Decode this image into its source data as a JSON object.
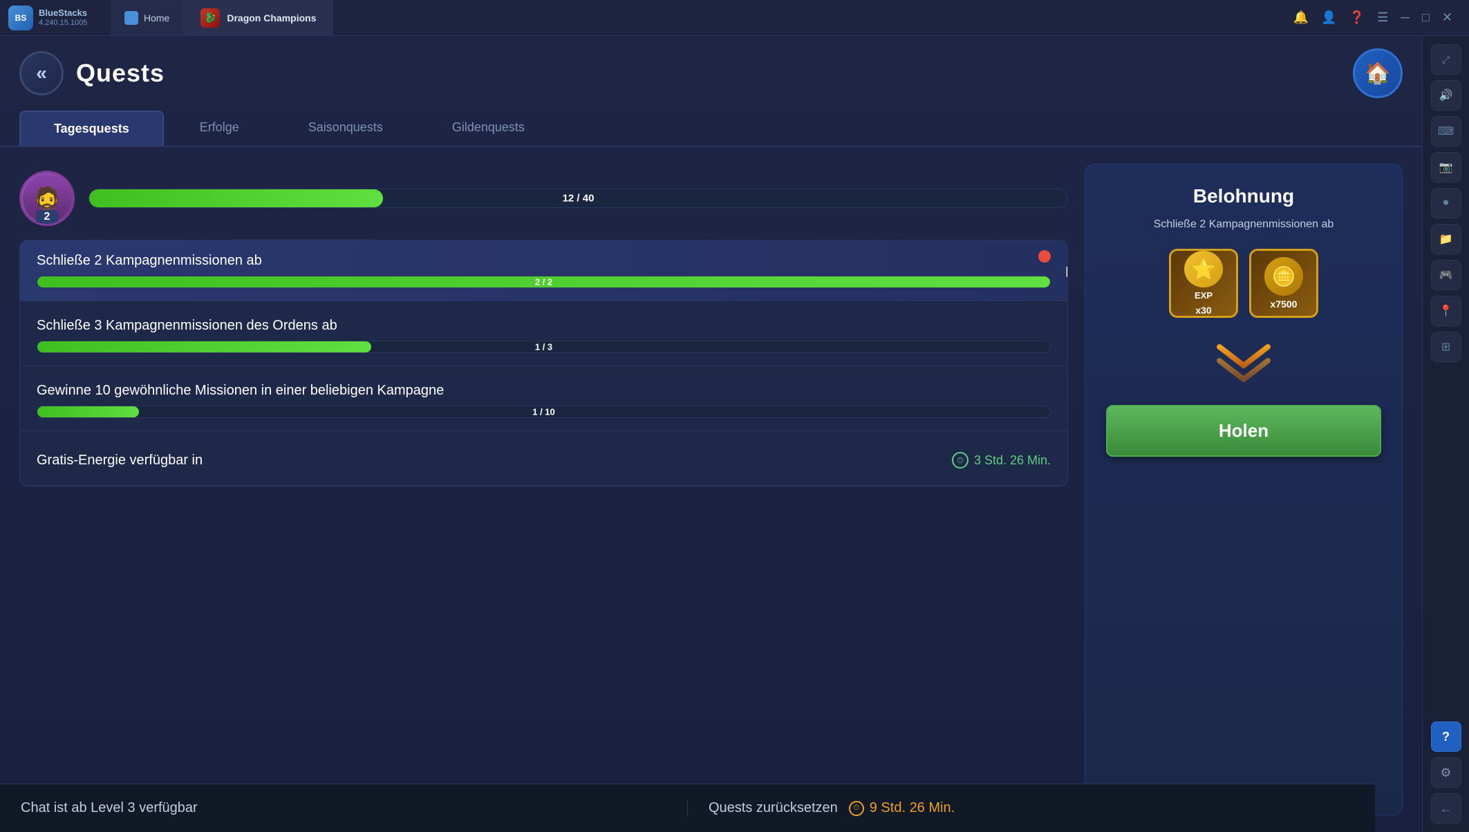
{
  "topbar": {
    "bluestacks_version": "4.240.15.1005",
    "home_tab": "Home",
    "game_tab": "Dragon Champions",
    "icons": [
      "bell",
      "profile",
      "question",
      "menu",
      "minimize",
      "maximize",
      "close"
    ]
  },
  "header": {
    "back_label": "«",
    "title": "Quests",
    "home_icon": "🏠"
  },
  "tabs": [
    {
      "id": "tagesquests",
      "label": "Tagesquests",
      "active": true
    },
    {
      "id": "erfolge",
      "label": "Erfolge",
      "active": false
    },
    {
      "id": "saisonquests",
      "label": "Saisonquests",
      "active": false
    },
    {
      "id": "gildenquests",
      "label": "Gildenquests",
      "active": false
    }
  ],
  "player": {
    "level": "2",
    "progress_current": "12",
    "progress_max": "40",
    "progress_text": "12 / 40",
    "progress_pct": 30
  },
  "quests": [
    {
      "id": "quest1",
      "title": "Schließe 2 Kampagnenmissionen ab",
      "progress_current": 2,
      "progress_max": 2,
      "progress_text": "2 / 2",
      "progress_pct": 100,
      "has_red_dot": true,
      "active": true
    },
    {
      "id": "quest2",
      "title": "Schließe 3 Kampagnenmissionen des Ordens ab",
      "progress_current": 1,
      "progress_max": 3,
      "progress_text": "1 / 3",
      "progress_pct": 33,
      "has_red_dot": false,
      "active": false
    },
    {
      "id": "quest3",
      "title": "Gewinne 10 gewöhnliche Missionen in einer beliebigen Kampagne",
      "progress_current": 1,
      "progress_max": 10,
      "progress_text": "1 / 10",
      "progress_pct": 10,
      "has_red_dot": false,
      "active": false
    }
  ],
  "energy_quest": {
    "label": "Gratis-Energie verfügbar in",
    "timer": "3 Std. 26 Min."
  },
  "reward_panel": {
    "title": "Belohnung",
    "description": "Schließe 2 Kampagnenmissionen ab",
    "rewards": [
      {
        "type": "exp",
        "icon": "⭐",
        "label": "x30"
      },
      {
        "type": "gold",
        "icon": "🪙",
        "label": "x7500"
      }
    ],
    "button_label": "Holen"
  },
  "bottom_bar": {
    "left_text": "Chat ist ab Level 3 verfügbar",
    "right_label": "Quests zurücksetzen",
    "timer": "9 Std. 26 Min."
  },
  "sidebar": {
    "buttons": [
      {
        "id": "expand",
        "icon": "⤢"
      },
      {
        "id": "sound",
        "icon": "🔊"
      },
      {
        "id": "controls",
        "icon": "⌨"
      },
      {
        "id": "camera",
        "icon": "📷"
      },
      {
        "id": "record",
        "icon": "⏺"
      },
      {
        "id": "folder",
        "icon": "📁"
      },
      {
        "id": "controller",
        "icon": "🎮"
      },
      {
        "id": "location",
        "icon": "📍"
      },
      {
        "id": "layers",
        "icon": "⊞"
      },
      {
        "id": "help",
        "icon": "?"
      },
      {
        "id": "settings",
        "icon": "⚙"
      },
      {
        "id": "back",
        "icon": "←"
      }
    ]
  }
}
